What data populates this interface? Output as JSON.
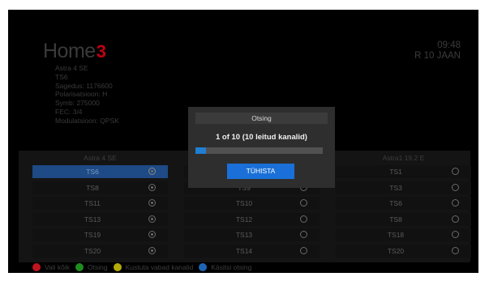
{
  "header": {
    "logo_text": "Home",
    "logo_mark": "3",
    "satellite": "Astra 4 SE",
    "transponder": "TS6",
    "frequency": "Sagedus: 1176600",
    "polarization": "Polarisatsioon: H",
    "symbol_rate": "Symb: 275000",
    "fec": "FEC: 3/4",
    "modulation": "Modulatsioon: QPSK",
    "time": "09:48",
    "date": "R 10 JAAN"
  },
  "columns": [
    {
      "title": "Astra 4 SE",
      "rows": [
        {
          "name": "TS6",
          "selected": true,
          "checked": true
        },
        {
          "name": "TS8",
          "selected": false,
          "checked": true
        },
        {
          "name": "TS11",
          "selected": false,
          "checked": true
        },
        {
          "name": "TS13",
          "selected": false,
          "checked": true
        },
        {
          "name": "TS19",
          "selected": false,
          "checked": true
        },
        {
          "name": "TS20",
          "selected": false,
          "checked": true
        }
      ]
    },
    {
      "title": "",
      "rows": [
        {
          "name": "",
          "selected": false,
          "checked": false
        },
        {
          "name": "TS9",
          "selected": false,
          "checked": false
        },
        {
          "name": "TS10",
          "selected": false,
          "checked": false
        },
        {
          "name": "TS12",
          "selected": false,
          "checked": false
        },
        {
          "name": "TS13",
          "selected": false,
          "checked": false
        },
        {
          "name": "TS14",
          "selected": false,
          "checked": false
        }
      ]
    },
    {
      "title": "Astra1 19.2 E",
      "rows": [
        {
          "name": "TS1",
          "selected": false,
          "checked": false
        },
        {
          "name": "TS3",
          "selected": false,
          "checked": false
        },
        {
          "name": "TS6",
          "selected": false,
          "checked": false
        },
        {
          "name": "TS8",
          "selected": false,
          "checked": false
        },
        {
          "name": "TS18",
          "selected": false,
          "checked": false
        },
        {
          "name": "TS20",
          "selected": false,
          "checked": false
        }
      ]
    }
  ],
  "legend": [
    {
      "color": "#c0141e",
      "label": "Vali kõik",
      "icon": "red-button-icon"
    },
    {
      "color": "#1e8c1e",
      "label": "Otsing",
      "icon": "green-button-icon"
    },
    {
      "color": "#b4aa0a",
      "label": "Kustuta vabad kanalid",
      "icon": "yellow-button-icon"
    },
    {
      "color": "#1e64b4",
      "label": "Käsitsi otsing",
      "icon": "blue-button-icon"
    }
  ],
  "dialog": {
    "title": "Otsing",
    "status": "1 of 10 (10 leitud kanalid)",
    "progress": 0.08,
    "cancel_label": "TÜHISTA"
  }
}
